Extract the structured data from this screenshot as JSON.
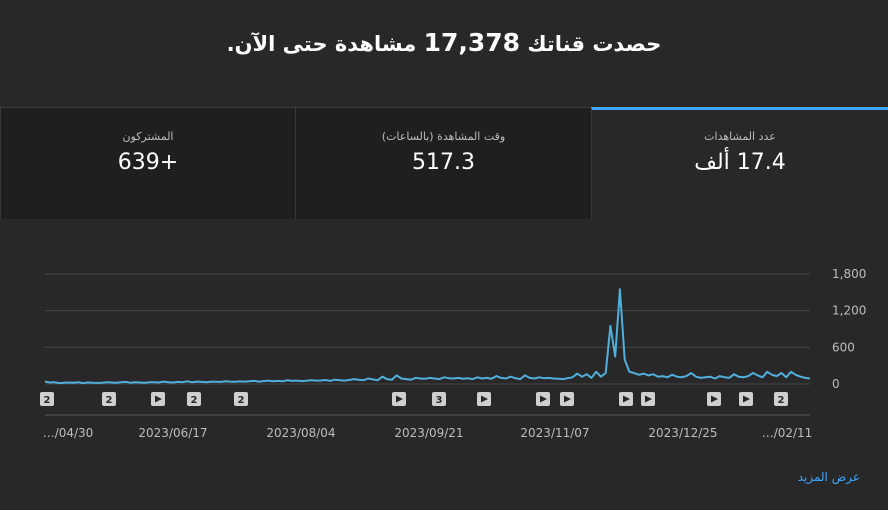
{
  "headline": {
    "prefix": "حصدت قناتك",
    "count": "17,378",
    "suffix": "مشاهدة حتى الآن."
  },
  "tabs": [
    {
      "key": "views",
      "label": "عدد المشاهدات",
      "value": "17.4 ألف",
      "selected": true
    },
    {
      "key": "watch",
      "label": "وقت المشاهدة (بالساعات)",
      "value": "517.3",
      "selected": false
    },
    {
      "key": "subs",
      "label": "المشتركون",
      "value": "+639",
      "selected": false
    }
  ],
  "colors": {
    "accent": "#3ea6ff",
    "line": "#4fb0dc",
    "grid": "#444444"
  },
  "chart_data": {
    "type": "line",
    "y_ticks": [
      "1,800",
      "1,200",
      "600",
      "0"
    ],
    "ylim": [
      0,
      1800
    ],
    "x_labels": [
      "…/04/30",
      "2023/06/17",
      "2023/08/04",
      "2023/09/21",
      "2023/11/07",
      "2023/12/25",
      "…/02/11"
    ],
    "series": [
      {
        "values": [
          40,
          25,
          30,
          15,
          20,
          25,
          20,
          30,
          15,
          25,
          20,
          18,
          22,
          30,
          25,
          20,
          28,
          35,
          22,
          30,
          25,
          20,
          28,
          30,
          25,
          40,
          30,
          25,
          35,
          30,
          45,
          28,
          40,
          35,
          30,
          40,
          38,
          35,
          45,
          40,
          38,
          42,
          40,
          45,
          50,
          40,
          48,
          55,
          45,
          50,
          45,
          60,
          50,
          55,
          48,
          52,
          60,
          55,
          58,
          65,
          50,
          70,
          60,
          55,
          65,
          80,
          70,
          60,
          90,
          75,
          60,
          120,
          80,
          70,
          140,
          90,
          80,
          70,
          100,
          90,
          85,
          100,
          90,
          80,
          110,
          95,
          90,
          100,
          85,
          95,
          80,
          110,
          90,
          100,
          85,
          130,
          100,
          90,
          120,
          95,
          80,
          140,
          100,
          90,
          110,
          95,
          100,
          90,
          85,
          80,
          95,
          110,
          170,
          120,
          160,
          100,
          200,
          120,
          180,
          950,
          450,
          1550,
          400,
          200,
          180,
          150,
          170,
          140,
          160,
          120,
          130,
          110,
          150,
          120,
          110,
          130,
          180,
          120,
          100,
          110,
          120,
          90,
          130,
          110,
          100,
          160,
          120,
          110,
          130,
          180,
          140,
          110,
          200,
          150,
          130,
          180,
          110,
          200,
          150,
          120,
          100,
          90
        ]
      }
    ]
  },
  "annotations": [
    {
      "label": "2",
      "kind": "count"
    },
    {
      "label": "2",
      "kind": "count"
    },
    {
      "label": "",
      "kind": "video"
    },
    {
      "label": "2",
      "kind": "count"
    },
    {
      "label": "2",
      "kind": "count"
    },
    {
      "label": "",
      "kind": "video"
    },
    {
      "label": "3",
      "kind": "count"
    },
    {
      "label": "",
      "kind": "video"
    },
    {
      "label": "",
      "kind": "video"
    },
    {
      "label": "",
      "kind": "video"
    },
    {
      "label": "",
      "kind": "video"
    },
    {
      "label": "",
      "kind": "video"
    },
    {
      "label": "",
      "kind": "video"
    },
    {
      "label": "",
      "kind": "video"
    },
    {
      "label": "2",
      "kind": "count"
    }
  ],
  "see_more": "عرض المزيد"
}
